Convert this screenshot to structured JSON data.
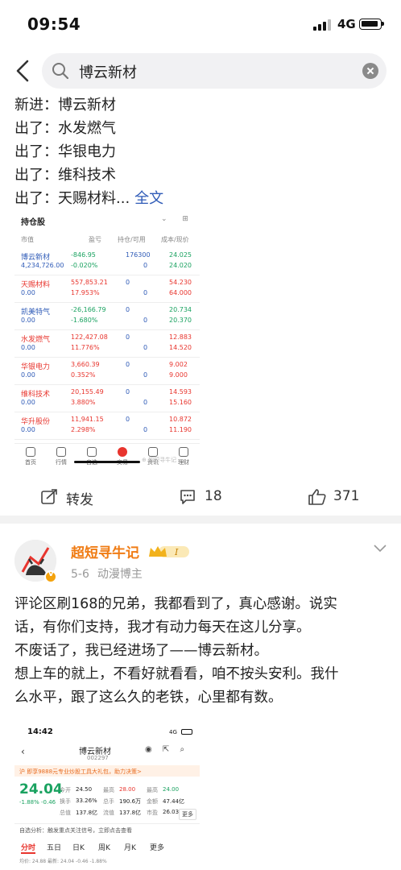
{
  "status_bar": {
    "time": "09:54",
    "network": "4G"
  },
  "search": {
    "query": "博云新材"
  },
  "post1": {
    "lines": [
      {
        "label": "新进：",
        "value": "博云新材"
      },
      {
        "label": "出了：",
        "value": "水发燃气"
      },
      {
        "label": "出了：",
        "value": "华银电力"
      },
      {
        "label": "出了：",
        "value": "维科技术"
      },
      {
        "label": "出了：",
        "value": "天赐材料..."
      }
    ],
    "full_text_link": "全文",
    "holdings": {
      "title": "持仓股",
      "columns": [
        "市值",
        "盈亏",
        "持仓/可用",
        "成本/现价"
      ],
      "rows": [
        {
          "name": "博云新材",
          "value": "4,234,726.00",
          "pnl": "-846.95",
          "pnl_pct": "-0.020%",
          "hold": "176300",
          "avail": "0",
          "cost": "24.025",
          "price": "24.020",
          "dir": "down"
        },
        {
          "name": "天赐材料",
          "value": "0.00",
          "pnl": "557,853.21",
          "pnl_pct": "17.953%",
          "hold": "0",
          "avail": "0",
          "cost": "54.230",
          "price": "64.000",
          "dir": "up"
        },
        {
          "name": "凯美特气",
          "value": "0.00",
          "pnl": "-26,166.79",
          "pnl_pct": "-1.680%",
          "hold": "0",
          "avail": "0",
          "cost": "20.734",
          "price": "20.370",
          "dir": "down"
        },
        {
          "name": "水发燃气",
          "value": "0.00",
          "pnl": "122,427.08",
          "pnl_pct": "11.776%",
          "hold": "0",
          "avail": "0",
          "cost": "12.883",
          "price": "14.520",
          "dir": "up"
        },
        {
          "name": "华银电力",
          "value": "0.00",
          "pnl": "3,660.39",
          "pnl_pct": "0.352%",
          "hold": "0",
          "avail": "0",
          "cost": "9.002",
          "price": "9.000",
          "dir": "up"
        },
        {
          "name": "维科技术",
          "value": "0.00",
          "pnl": "20,155.49",
          "pnl_pct": "3.880%",
          "hold": "0",
          "avail": "0",
          "cost": "14.593",
          "price": "15.160",
          "dir": "up"
        },
        {
          "name": "华升股份",
          "value": "0.00",
          "pnl": "11,941.15",
          "pnl_pct": "2.298%",
          "hold": "0",
          "avail": "0",
          "cost": "10.872",
          "price": "11.190",
          "dir": "up"
        }
      ],
      "tabs": [
        "首页",
        "行情",
        "自选",
        "交易",
        "资讯",
        "理财"
      ]
    },
    "actions": {
      "repost": "转发",
      "comments": "18",
      "likes": "371"
    }
  },
  "post2": {
    "author": "超短寻牛记",
    "level": "I",
    "date": "5-6",
    "role": "动漫博主",
    "body": [
      "评论区刷168的兄弟，我都看到了，真心感谢。说实",
      "话，有你们支持，我才有动力每天在这儿分享。",
      "不废话了，我已经进场了——博云新材。",
      "想上车的就上，不看好就看看，咱不按头安利。我什",
      "么水平，跟了这么久的老铁，心里都有数。"
    ],
    "stock_card": {
      "time": "14:42",
      "network": "4G",
      "name": "博云新材",
      "code": "002297",
      "banner": "沪 即享9888元专业炒股工具大礼包，助力决策>",
      "price": "24.04",
      "change": "-1.88%  -0.46",
      "stats": [
        [
          "今开",
          "24.50",
          "最高",
          "28.00",
          "最高",
          "24.00"
        ],
        [
          "换手",
          "33.26%",
          "总手",
          "190.6万",
          "金额",
          "47.44亿"
        ],
        [
          "总值",
          "137.8亿",
          "流值",
          "137.8亿",
          "市盈",
          "26.03"
        ]
      ],
      "more": "更多",
      "analysis": "自选分析：触发重点关注信号，立即点击查看",
      "tabs": [
        "分时",
        "五日",
        "日K",
        "周K",
        "月K",
        "更多"
      ],
      "bottom": "均价: 24.88  最新: 24.04  -0.46  -1.88%"
    }
  },
  "colors": {
    "up": "#e8352e",
    "down": "#1aa260",
    "link": "#2f5bb7",
    "author": "#f07c14"
  }
}
